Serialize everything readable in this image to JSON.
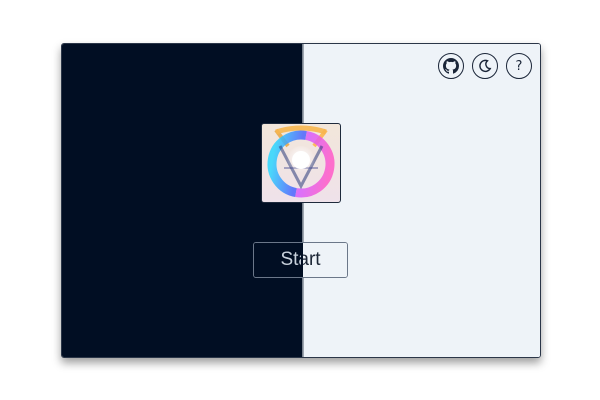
{
  "toolbar": {
    "icons": [
      {
        "name": "github-icon"
      },
      {
        "name": "moon-icon"
      },
      {
        "name": "help-icon",
        "glyph": "?"
      }
    ]
  },
  "theme": {
    "dark_bg": "#010e23",
    "light_bg": "#eef3f8",
    "border": "#1a2538"
  },
  "main": {
    "start_label": "Start"
  }
}
